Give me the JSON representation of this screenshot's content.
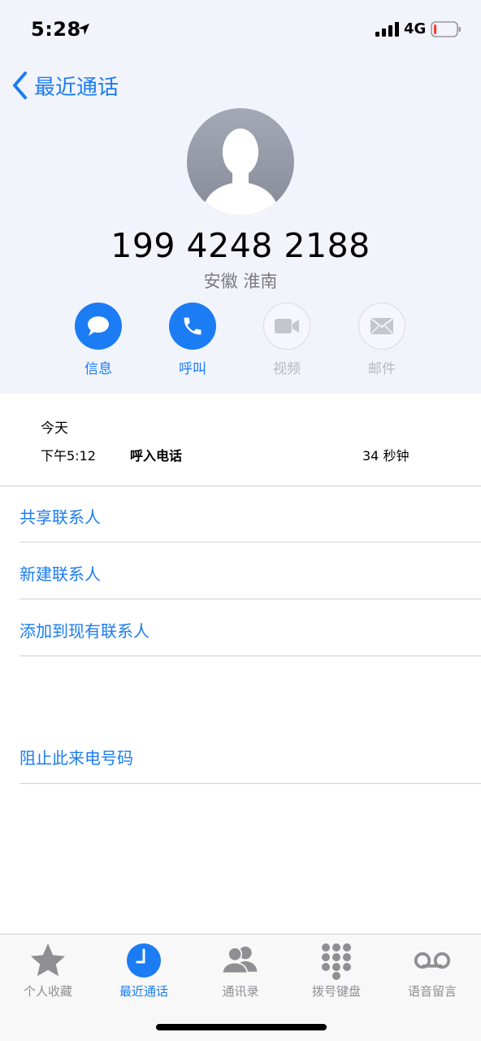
{
  "status_bar": {
    "time": "5:28",
    "network": "4G",
    "battery_level": 0.12,
    "battery_color": "#ff3b30"
  },
  "nav": {
    "back_label": "最近通话"
  },
  "contact": {
    "phone_number": "199 4248 2188",
    "location": "安徽 淮南"
  },
  "actions": [
    {
      "label": "信息",
      "icon": "message-bubble-icon",
      "enabled": true
    },
    {
      "label": "呼叫",
      "icon": "phone-icon",
      "enabled": true
    },
    {
      "label": "视频",
      "icon": "video-camera-icon",
      "enabled": false
    },
    {
      "label": "邮件",
      "icon": "mail-envelope-icon",
      "enabled": false
    }
  ],
  "call_log": {
    "day": "今天",
    "time": "下午5:12",
    "type": "呼入电话",
    "duration": "34 秒钟"
  },
  "options": {
    "share_contact": "共享联系人",
    "new_contact": "新建联系人",
    "add_to_existing": "添加到现有联系人",
    "block_caller": "阻止此来电号码"
  },
  "tabs": [
    {
      "label": "个人收藏",
      "icon": "star-icon",
      "active": false
    },
    {
      "label": "最近通话",
      "icon": "clock-icon",
      "active": true
    },
    {
      "label": "通讯录",
      "icon": "contacts-icon",
      "active": false
    },
    {
      "label": "拨号键盘",
      "icon": "keypad-icon",
      "active": false
    },
    {
      "label": "语音留言",
      "icon": "voicemail-icon",
      "active": false
    }
  ],
  "colors": {
    "accent": "#1b7cf4",
    "header_bg": "#f2f4fb",
    "inactive_gray": "#8e8e93",
    "disabled_gray": "#b7b9c0"
  }
}
